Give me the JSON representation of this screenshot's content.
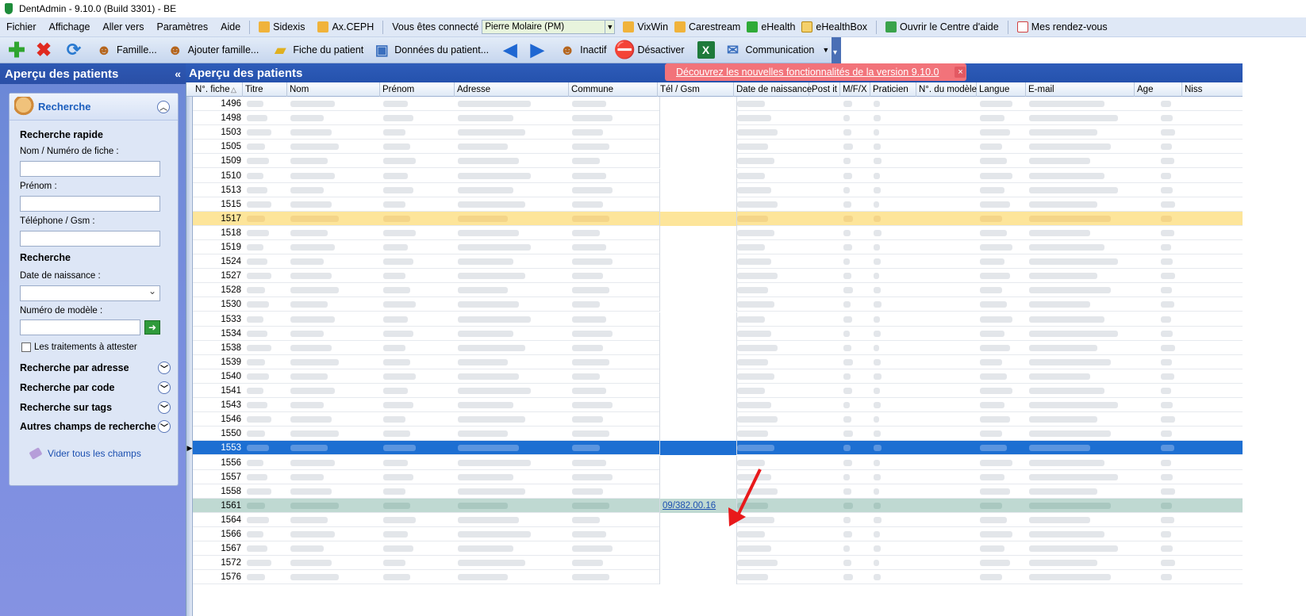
{
  "window": {
    "title": "DentAdmin - 9.10.0     (Build 3301) - BE"
  },
  "menubar": {
    "items": [
      "Fichier",
      "Affichage",
      "Aller vers",
      "Paramètres",
      "Aide"
    ],
    "sidexis": "Sidexis",
    "axceph": "Ax.CEPH",
    "connected_label": "Vous êtes connecté",
    "user_combo": "Pierre Molaire (PM)",
    "vixwin": "VixWin",
    "carestream": "Carestream",
    "ehealth": "eHealth",
    "ehealthbox": "eHealthBox",
    "help_center": "Ouvrir le Centre d'aide",
    "appointments": "Mes rendez-vous"
  },
  "toolbar": {
    "family": "Famille...",
    "add_family": "Ajouter famille...",
    "patient_card": "Fiche du patient",
    "patient_data": "Données du patient...",
    "inactive": "Inactif",
    "deactivate": "Désactiver",
    "communication": "Communication"
  },
  "sidebar": {
    "title": "Aperçu des patients",
    "collapse": "«",
    "search_title": "Recherche",
    "quick_search": "Recherche rapide",
    "name_label": "Nom / Numéro de fiche :",
    "firstname_label": "Prénom :",
    "phone_label": "Téléphone / Gsm :",
    "search_section": "Recherche",
    "birthdate_label": "Date de naissance :",
    "model_label": "Numéro de modèle :",
    "treatments_checkbox": "Les traitements à attester",
    "by_address": "Recherche par adresse",
    "by_code": "Recherche par code",
    "by_tags": "Recherche sur tags",
    "other_fields": "Autres champs de recherche",
    "clear_all": "Vider tous les champs"
  },
  "main": {
    "title": "Aperçu des patients",
    "banner_link": "Découvrez les nouvelles fonctionnalités de la version 9.10.0",
    "banner_close": "×"
  },
  "columns": [
    "N°. fiche",
    "Titre",
    "Nom",
    "Prénom",
    "Adresse",
    "Commune",
    "Tél / Gsm",
    "Date de naissance",
    "Post it",
    "M/F/X",
    "Praticien",
    "N°. du modèle",
    "Langue",
    "E-mail",
    "Age",
    "Niss"
  ],
  "rows": [
    {
      "num": "1496",
      "tel": ""
    },
    {
      "num": "1498",
      "tel": ""
    },
    {
      "num": "1503",
      "tel": ""
    },
    {
      "num": "1505",
      "tel": ""
    },
    {
      "num": "1509",
      "tel": ""
    },
    {
      "num": "1510",
      "tel": ""
    },
    {
      "num": "1513",
      "tel": ""
    },
    {
      "num": "1515",
      "tel": ""
    },
    {
      "num": "1517",
      "tel": ""
    },
    {
      "num": "1518",
      "tel": ""
    },
    {
      "num": "1519",
      "tel": ""
    },
    {
      "num": "1524",
      "tel": ""
    },
    {
      "num": "1527",
      "tel": ""
    },
    {
      "num": "1528",
      "tel": ""
    },
    {
      "num": "1530",
      "tel": ""
    },
    {
      "num": "1533",
      "tel": ""
    },
    {
      "num": "1534",
      "tel": ""
    },
    {
      "num": "1538",
      "tel": ""
    },
    {
      "num": "1539",
      "tel": ""
    },
    {
      "num": "1540",
      "tel": ""
    },
    {
      "num": "1541",
      "tel": ""
    },
    {
      "num": "1543",
      "tel": ""
    },
    {
      "num": "1546",
      "tel": ""
    },
    {
      "num": "1550",
      "tel": ""
    },
    {
      "num": "1553",
      "tel": ""
    },
    {
      "num": "1556",
      "tel": ""
    },
    {
      "num": "1557",
      "tel": ""
    },
    {
      "num": "1558",
      "tel": ""
    },
    {
      "num": "1561",
      "tel": "09/382.00.16"
    },
    {
      "num": "1564",
      "tel": ""
    },
    {
      "num": "1566",
      "tel": ""
    },
    {
      "num": "1567",
      "tel": ""
    },
    {
      "num": "1572",
      "tel": ""
    },
    {
      "num": "1576",
      "tel": ""
    }
  ],
  "colors": {
    "accent": "#2552ad",
    "selected_row": "#1d6fd2",
    "yellow_row": "#fde59a",
    "green_row": "#bfd9d2",
    "banner": "#f2737a"
  }
}
